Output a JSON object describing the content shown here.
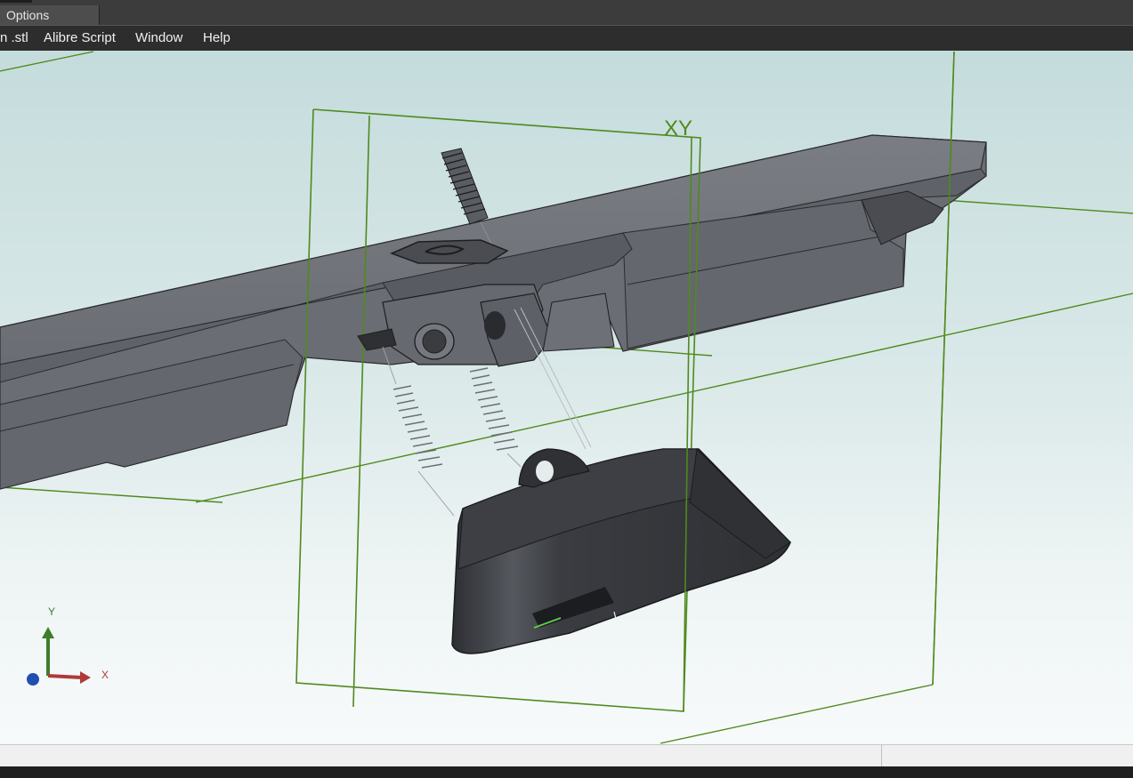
{
  "toolbar": {
    "options_tab_label": "Options"
  },
  "menubar": {
    "items": [
      {
        "label": "n .stl"
      },
      {
        "label": "Alibre Script"
      },
      {
        "label": "Window"
      },
      {
        "label": "Help"
      }
    ]
  },
  "viewport": {
    "plane_label": "XY",
    "axis_triad": {
      "y_label": "Y",
      "x_label": "X"
    },
    "colors": {
      "sketch_plane": "#4f8a1e",
      "model_body": "#6b6e74",
      "pendant": "#3c3e43",
      "axis_y": "#3e7d2a",
      "axis_x": "#b03a3a",
      "axis_z": "#1f4fb0"
    }
  },
  "statusbar": {
    "left_text": "",
    "right_text": ""
  }
}
